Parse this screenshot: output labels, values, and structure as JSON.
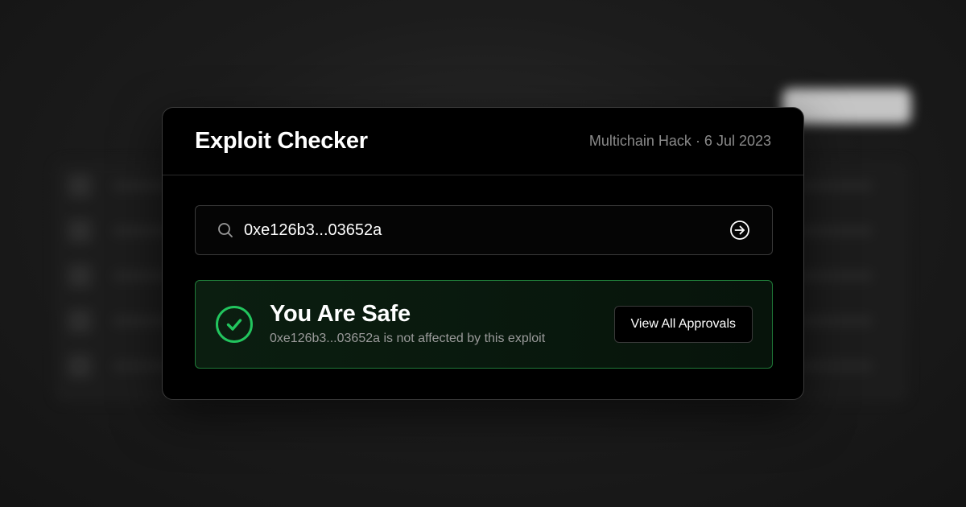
{
  "card": {
    "title": "Exploit Checker",
    "meta": "Multichain Hack · 6 Jul 2023"
  },
  "search": {
    "value": "0xe126b3...03652a",
    "icon": "search-icon",
    "submit_icon": "arrow-right-circle-icon"
  },
  "result": {
    "status_icon": "check-circle-icon",
    "title": "You Are Safe",
    "subtitle": "0xe126b3...03652a is not affected by this exploit",
    "button_label": "View All Approvals",
    "accent_color": "#22c55e"
  }
}
